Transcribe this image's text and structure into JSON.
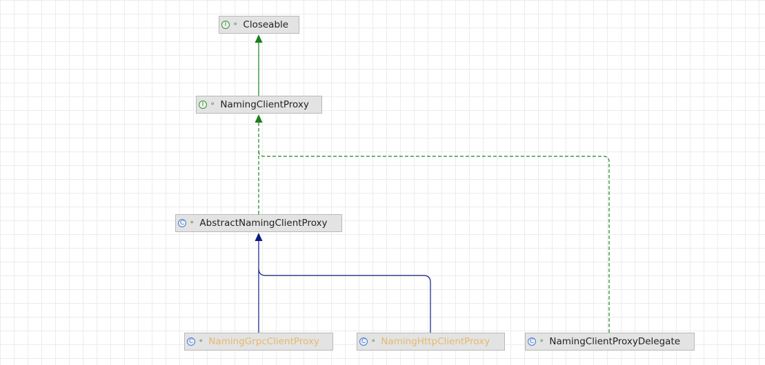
{
  "diagram": {
    "nodes": {
      "closeable": {
        "kind_glyph": "I",
        "kind": "interface",
        "visibility_icon": "public-open-lock-icon",
        "label": "Closeable"
      },
      "naming_client_proxy": {
        "kind_glyph": "I",
        "kind": "interface",
        "visibility_icon": "public-open-lock-icon",
        "label": "NamingClientProxy"
      },
      "abstract_naming_client_proxy": {
        "kind_glyph": "C",
        "kind": "class",
        "visibility_icon": "public-open-lock-icon",
        "label": "AbstractNamingClientProxy"
      },
      "naming_grpc_client_proxy": {
        "kind_glyph": "C",
        "kind": "class",
        "visibility_icon": "public-open-lock-icon",
        "label": "NamingGrpcClientProxy"
      },
      "naming_http_client_proxy": {
        "kind_glyph": "C",
        "kind": "class",
        "visibility_icon": "public-open-lock-icon",
        "label": "NamingHttpClientProxy"
      },
      "naming_client_proxy_delegate": {
        "kind_glyph": "C",
        "kind": "class",
        "visibility_icon": "public-open-lock-icon",
        "label": "NamingClientProxyDelegate"
      }
    },
    "edges": [
      {
        "from": "naming_client_proxy",
        "to": "closeable",
        "relation": "extends",
        "style": "solid",
        "color": "#1a7f1a"
      },
      {
        "from": "abstract_naming_client_proxy",
        "to": "naming_client_proxy",
        "relation": "implements",
        "style": "dashed",
        "color": "#1a7f1a"
      },
      {
        "from": "naming_client_proxy_delegate",
        "to": "naming_client_proxy",
        "relation": "implements",
        "style": "dashed",
        "color": "#1a7f1a"
      },
      {
        "from": "naming_grpc_client_proxy",
        "to": "abstract_naming_client_proxy",
        "relation": "extends",
        "style": "solid",
        "color": "#0d1a80"
      },
      {
        "from": "naming_http_client_proxy",
        "to": "abstract_naming_client_proxy",
        "relation": "extends",
        "style": "solid",
        "color": "#0d1a80"
      }
    ],
    "colors": {
      "interface_relation": "#1a7f1a",
      "class_relation": "#0d1a80",
      "node_fill": "#e3e3e3",
      "muted_label": "#e5b96b"
    }
  }
}
